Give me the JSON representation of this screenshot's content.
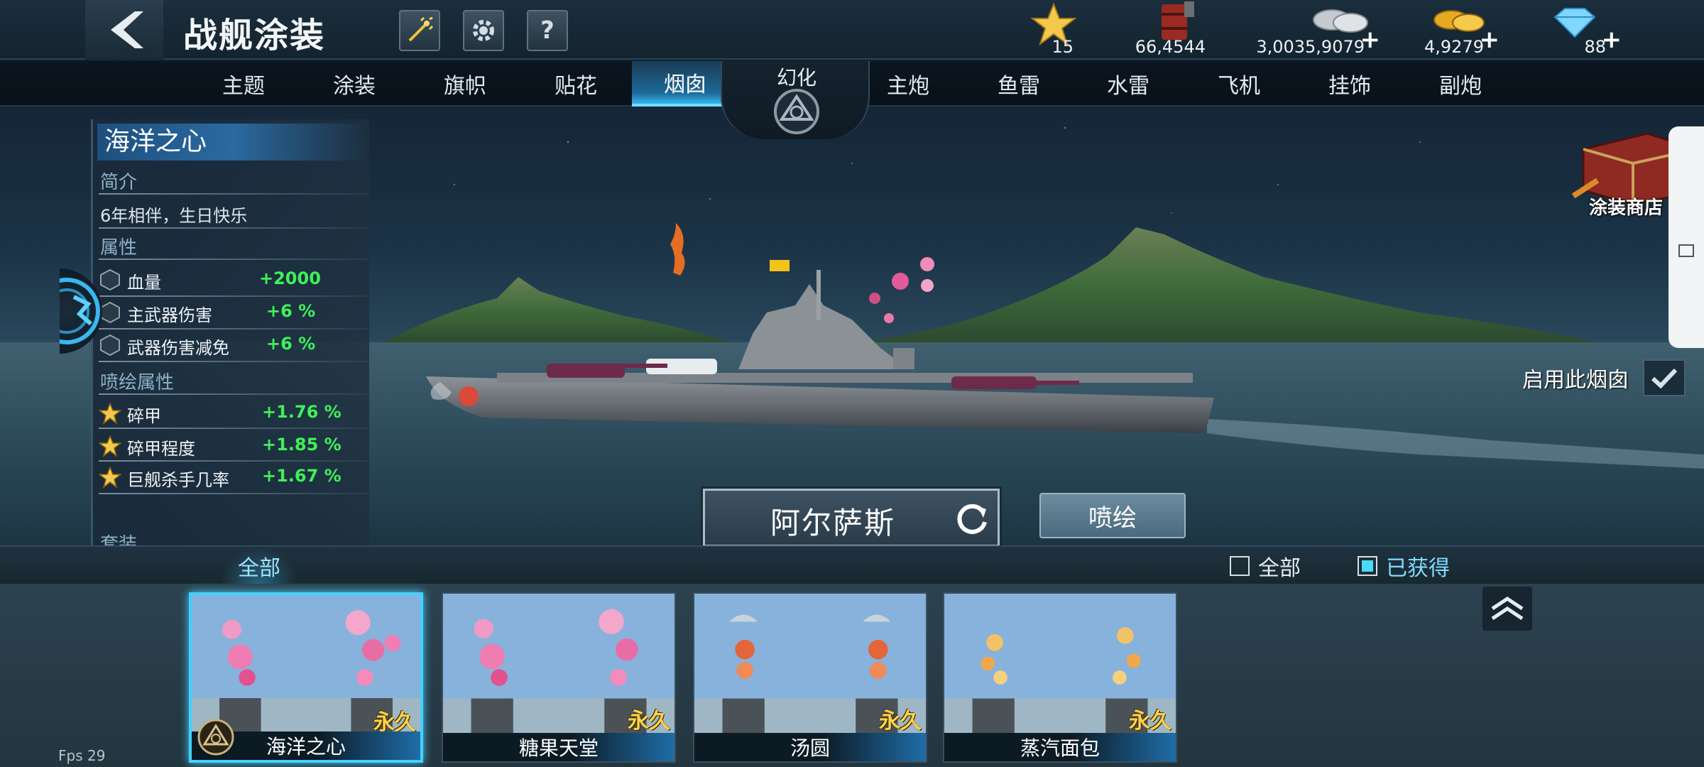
{
  "header": {
    "title": "战舰涂装",
    "help_label": "?",
    "resources": [
      {
        "name": "star",
        "icon": "star-icon",
        "value": "15",
        "has_plus": false
      },
      {
        "name": "oil",
        "icon": "oil-barrel-icon",
        "value": "66,4544",
        "has_plus": false
      },
      {
        "name": "silver",
        "icon": "silver-coin-icon",
        "value": "3,0035,9079",
        "has_plus": true
      },
      {
        "name": "gold",
        "icon": "gold-coin-icon",
        "value": "4,9279",
        "has_plus": true
      },
      {
        "name": "diamond",
        "icon": "diamond-icon",
        "value": "88",
        "has_plus": true
      }
    ],
    "plus_label": "+"
  },
  "tabs": {
    "left": [
      "主题",
      "涂装",
      "旗帜",
      "贴花",
      "烟囱"
    ],
    "active": "烟囱",
    "center": "幻化",
    "right": [
      "主炮",
      "鱼雷",
      "水雷",
      "飞机",
      "挂饰",
      "副炮"
    ]
  },
  "info": {
    "skin_name": "海洋之心",
    "intro_heading": "简介",
    "intro_text": "6年相伴，生日快乐",
    "attr_heading": "属性",
    "attrs": [
      {
        "name": "血量",
        "value": "+2000"
      },
      {
        "name": "主武器伤害",
        "value": "+6 %"
      },
      {
        "name": "武器伤害减免",
        "value": "+6 %"
      }
    ],
    "spray_heading": "喷绘属性",
    "spray_attrs": [
      {
        "name": "碎甲",
        "value": "+1.76 %"
      },
      {
        "name": "碎甲程度",
        "value": "+1.85 %"
      },
      {
        "name": "巨舰杀手几率",
        "value": "+1.67 %"
      }
    ],
    "set_heading": "套装"
  },
  "shop_label": "涂装商店",
  "enable_label": "启用此烟囱",
  "ship_name": "阿尔萨斯",
  "spray_label": "喷绘",
  "filter": {
    "category": "全部",
    "options": [
      {
        "label": "全部",
        "checked": false
      },
      {
        "label": "已获得",
        "checked": true
      }
    ]
  },
  "items": [
    {
      "name": "海洋之心",
      "tag": "永久",
      "selected": true,
      "style": "balloons"
    },
    {
      "name": "糖果天堂",
      "tag": "永久",
      "selected": false,
      "style": "balloons"
    },
    {
      "name": "汤圆",
      "tag": "永久",
      "selected": false,
      "style": "parachute"
    },
    {
      "name": "蒸汽面包",
      "tag": "永久",
      "selected": false,
      "style": "steam"
    }
  ],
  "fps": "Fps 29",
  "colors": {
    "accent": "#43d1ff",
    "positive": "#3ef05a",
    "permanent": "#ffd24a"
  }
}
